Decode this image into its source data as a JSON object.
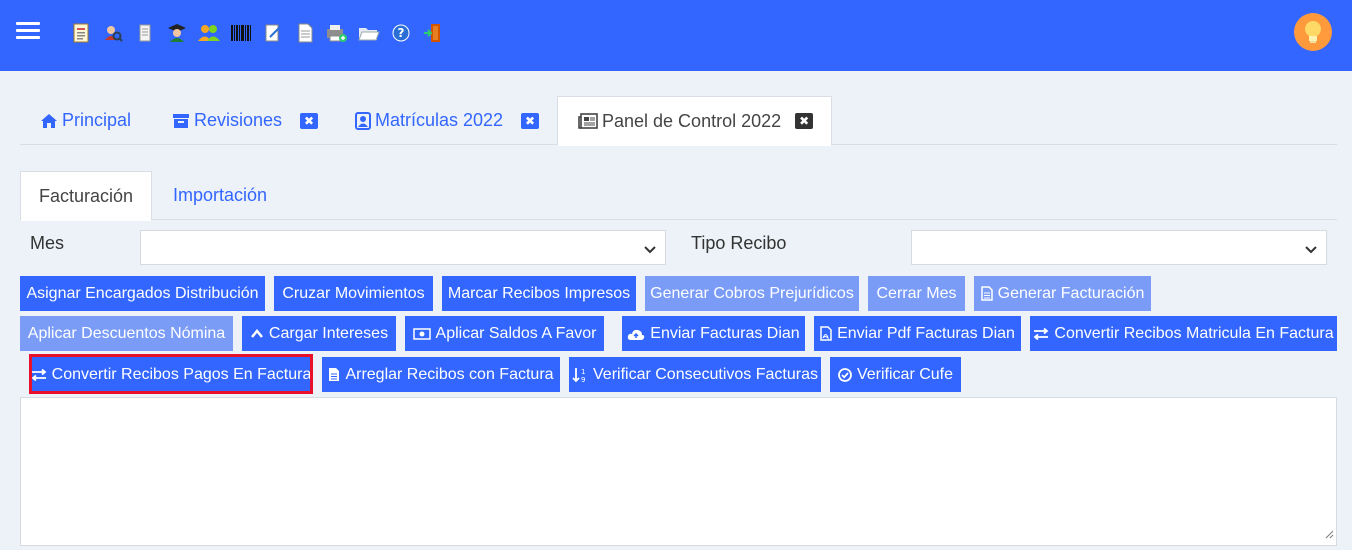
{
  "colors": {
    "primary": "#3366ff",
    "primary_light": "#7a9cf7",
    "highlight": "#e8102a",
    "background": "#ecf2f7"
  },
  "header": {
    "menu_icon": "hamburger-menu-icon",
    "toolbar_icons": [
      "report-icon",
      "search-users-icon",
      "receipt-icon",
      "student-icon",
      "group-icon",
      "barcode-icon",
      "edit-document-icon",
      "document-icon",
      "print-add-icon",
      "folder-open-icon",
      "help-icon",
      "exit-door-icon"
    ],
    "avatar_icon": "lightbulb-icon"
  },
  "main_tabs": [
    {
      "label": "Principal",
      "icon": "home-icon"
    },
    {
      "label": "Revisiones",
      "icon": "archive-icon",
      "close": "✖"
    },
    {
      "label": "Matrículas 2022",
      "icon": "address-book-icon",
      "close": "✖"
    },
    {
      "label": "Panel de Control 2022",
      "icon": "newspaper-icon",
      "close": "✖",
      "active": true
    }
  ],
  "sub_tabs": [
    {
      "label": "Facturación",
      "active": true
    },
    {
      "label": "Importación"
    }
  ],
  "filters": {
    "mes_label": "Mes",
    "mes_value": "",
    "tipo_label": "Tipo Recibo",
    "tipo_value": ""
  },
  "buttons": {
    "row1": [
      {
        "label": "Asignar Encargados Distribución"
      },
      {
        "label": "Cruzar Movimientos"
      },
      {
        "label": "Marcar Recibos Impresos"
      },
      {
        "label": "Generar Cobros Prejurídicos",
        "disabled": true
      },
      {
        "label": "Cerrar Mes",
        "disabled": true
      },
      {
        "label": "Generar Facturación",
        "icon": "file-text-icon",
        "disabled": true
      }
    ],
    "row2": [
      {
        "label": "Aplicar Descuentos Nómina",
        "disabled": true
      },
      {
        "label": "Cargar Intereses",
        "icon": "chevron-up-icon"
      },
      {
        "label": "Aplicar Saldos A Favor",
        "icon": "money-icon"
      },
      {
        "label": "Enviar Facturas Dian",
        "icon": "cloud-upload-icon"
      },
      {
        "label": "Enviar Pdf Facturas Dian",
        "icon": "file-pdf-icon"
      },
      {
        "label": "Convertir Recibos Matricula En Factura",
        "icon": "exchange-icon"
      }
    ],
    "row3": [
      {
        "label": "Convertir Recibos Pagos En Factura",
        "icon": "exchange-icon",
        "highlighted": true
      },
      {
        "label": "Arreglar Recibos con Factura",
        "icon": "file-icon"
      },
      {
        "label": "Verificar Consecutivos Facturas",
        "icon": "sort-numeric-icon"
      },
      {
        "label": "Verificar Cufe",
        "icon": "check-circle-icon"
      }
    ]
  },
  "output_text": ""
}
